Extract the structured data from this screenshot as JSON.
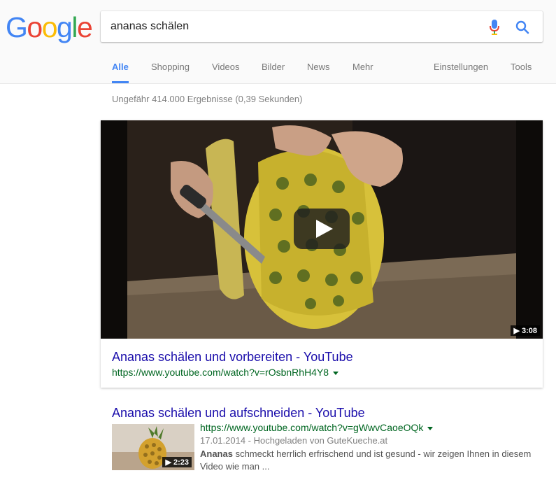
{
  "logo": {
    "letters": [
      "G",
      "o",
      "o",
      "g",
      "l",
      "e"
    ],
    "colors": [
      "#4285f4",
      "#ea4335",
      "#fbbc05",
      "#4285f4",
      "#34a853",
      "#ea4335"
    ]
  },
  "search": {
    "query": "ananas schälen",
    "mic_icon": "microphone-icon",
    "search_icon": "magnifier-icon"
  },
  "tabs": [
    "Alle",
    "Shopping",
    "Videos",
    "Bilder",
    "News",
    "Mehr",
    "Einstellungen",
    "Tools"
  ],
  "stats": "Ungefähr 414.000 Ergebnisse (0,39 Sekunden)",
  "results": [
    {
      "title": "Ananas schälen und vorbereiten - YouTube",
      "url": "https://www.youtube.com/watch?v=rOsbnRhH4Y8",
      "duration": "▶ 3:08"
    },
    {
      "title": "Ananas schälen und aufschneiden - YouTube",
      "url": "https://www.youtube.com/watch?v=gWwvCaoeOQk",
      "duration": "▶ 2:23",
      "meta": "17.01.2014 - Hochgeladen von GuteKueche.at",
      "snippet_bold": "Ananas",
      "snippet_rest": " schmeckt herrlich erfrischend und ist gesund - wir zeigen Ihnen in diesem Video wie man ..."
    }
  ],
  "colors": {
    "accent": "#4285f4",
    "link": "#1a0dab",
    "url": "#006621"
  }
}
